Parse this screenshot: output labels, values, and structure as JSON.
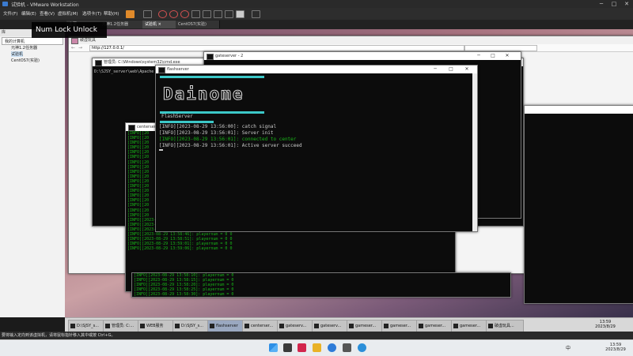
{
  "vmware": {
    "title": "试验机 - VMware Workstation",
    "menu": [
      "文件(F)",
      "编辑(E)",
      "查看(V)",
      "虚拟机(M)",
      "选项卡(T)",
      "帮助(H)"
    ],
    "tabs": [
      "主页",
      "元神1.2任务器",
      "试验机",
      "CentOS7(实验)"
    ],
    "library_title": "库",
    "library_items": [
      "我的计算机",
      "元神1.2任务器",
      "试验机",
      "CentOS7(实验)"
    ],
    "status_text": "要将输入定向到该虚拟机，请将鼠标指针移入其中或按 Ctrl+G。",
    "numlock_text": "Num Lock Unlock"
  },
  "browser": {
    "url": "http://127.0.0.1/",
    "tab": "破虚玩具"
  },
  "cmd_window": {
    "title": "管理员: C:\\Windows\\system32\\cmd.exe",
    "tab_title": "就是玩玩目前输的",
    "path_line": "D:\\SJSY_server\\web\\Apache"
  },
  "gateserver_window": {
    "title": "gateserver - 2"
  },
  "centerserver_window": {
    "title": "centerserver"
  },
  "flash_window": {
    "title": "flashserver",
    "logo": "Dainome",
    "label": "FlashServer",
    "logs": [
      {
        "text": "[INFO][2023-08-29 13:56:00]: catch signal",
        "color": "#cccccc"
      },
      {
        "text": "[INFO][2023-08-29 13:56:01]: Server init",
        "color": "#cccccc"
      },
      {
        "text": "[INFO][2023-08-29 13:56:01]: connected to center",
        "color": "#18b518"
      },
      {
        "text": "[INFO][2023-08-29 13:56:01]: Active server succeed",
        "color": "#cccccc"
      }
    ]
  },
  "game_window": {
    "short_tag": "[INFO][20",
    "logs": [
      "[INFO][2023-08-29 13:58:21]: playernum = 0 0",
      "[INFO][2023-08-29 13:58:31]: playernum = 0 0",
      "[INFO][2023-08-29 13:58:41]: playernum = 0 0",
      "[INFO][2023-08-29 13:58:46]: playernum = 0 0",
      "[INFO][2023-08-29 13:58:51]: playernum = 0 0",
      "[INFO][2023-08-29 13:59:01]: playernum = 0 0",
      "[INFO][2023-08-29 13:59:06]: playernum = 0 0"
    ],
    "lower_logs": [
      "[INFO][2023-08-29 13:58:10]: playernum = 0",
      "[INFO][2023-08-29 13:58:15]: playernum = 0",
      "[INFO][2023-08-29 13:58:20]: playernum = 0",
      "[INFO][2023-08-29 13:58:25]: playernum = 0",
      "[INFO][2023-08-29 13:58:30]: playernum = 0"
    ]
  },
  "guest_taskbar": {
    "items": [
      "D:\\SJSY_s...",
      "管理员: C:...",
      "WEB服务",
      "D:\\SJSY_s...",
      "flashserver",
      "centerser...",
      "gateserv...",
      "gateserv...",
      "gameser...",
      "gameser...",
      "gameser...",
      "gameser...",
      "破虚玩具..."
    ],
    "time": "13:59",
    "date": "2023/8/29"
  },
  "host_taskbar": {
    "time": "13:59",
    "date": "2023/8/29",
    "lang": "中"
  }
}
